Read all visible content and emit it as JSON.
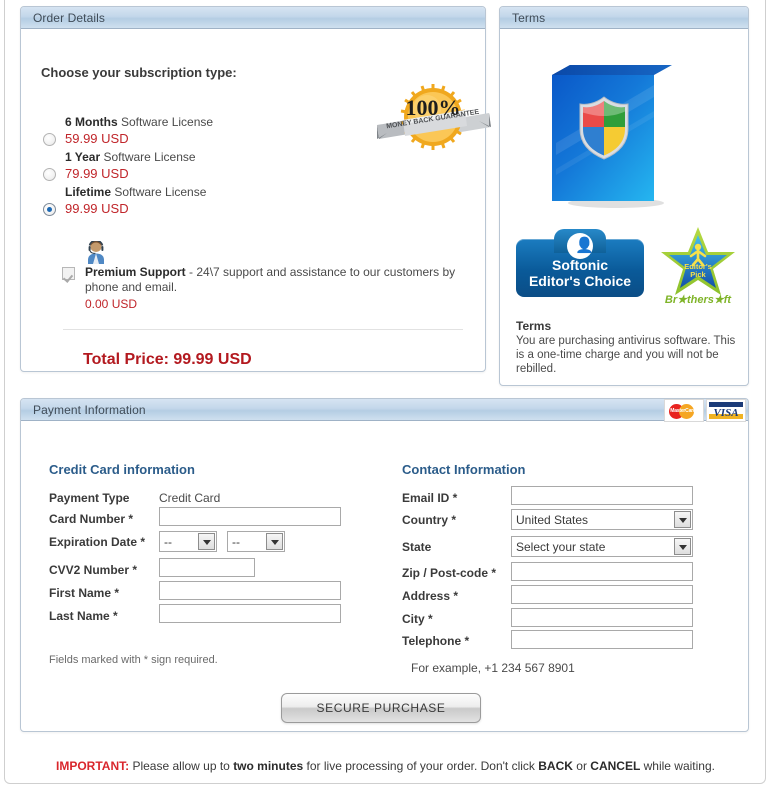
{
  "page": {
    "background": "#ffffff",
    "accent_blue": "#2b5c8a",
    "price_red": "#c0252a",
    "panel_border": "#b9c6d4"
  },
  "order_panel": {
    "title": "Order Details",
    "subscription_prompt": "Choose your subscription type:",
    "options": [
      {
        "term": "6 Months",
        "suffix": " Software License",
        "price": "59.99 USD",
        "selected": false
      },
      {
        "term": "1 Year",
        "suffix": " Software License",
        "price": "79.99 USD",
        "selected": false
      },
      {
        "term": "Lifetime",
        "suffix": " Software License",
        "price": "99.99 USD",
        "selected": true
      }
    ],
    "seal": {
      "percent_label": "100%",
      "ribbon_label": "MONEY BACK GUARANTEE",
      "icon_name": "money-back-guarantee-seal"
    },
    "premium_support": {
      "checked": true,
      "enabled": false,
      "title": "Premium Support",
      "description": " - 24\\7 support and assistance to our customers by phone and email.",
      "price": "0.00 USD",
      "icon_name": "support-agent-icon"
    },
    "total": {
      "label": "Total Price:",
      "value": "99.99 USD"
    }
  },
  "terms_panel": {
    "title": "Terms",
    "product_box": {
      "icon_name": "antivirus-software-box-shield"
    },
    "badges": [
      {
        "line1": "Softonic",
        "line2": "Editor's Choice",
        "icon_name": "softonic-editors-choice-badge"
      },
      {
        "star_line1": "Editor's",
        "star_line2": "Pick",
        "brand": "Br★thers★ft",
        "icon_name": "brothersoft-editors-pick-badge"
      }
    ],
    "terms_heading": "Terms",
    "terms_body": "You are purchasing antivirus software. This is a one-time charge and you will not be rebilled."
  },
  "payment_panel": {
    "title": "Payment Information",
    "card_logos": [
      {
        "name": "mastercard-logo",
        "label": "MasterCard"
      },
      {
        "name": "visa-logo",
        "label": "VISA"
      }
    ],
    "credit_card": {
      "heading": "Credit Card information",
      "payment_type_label": "Payment Type",
      "payment_type_value": "Credit Card",
      "card_number_label": "Card Number *",
      "card_number_value": "",
      "expiration_label": "Expiration Date *",
      "expiration_month": "--",
      "expiration_year": "--",
      "cvv_label": "CVV2 Number *",
      "cvv_value": "",
      "first_name_label": "First Name *",
      "first_name_value": "",
      "last_name_label": "Last Name *",
      "last_name_value": "",
      "required_note": "Fields marked with * sign required."
    },
    "contact": {
      "heading": "Contact Information",
      "email_label": "Email ID *",
      "email_value": "",
      "country_label": "Country *",
      "country_value": "United States",
      "state_label": "State",
      "state_value": "Select your state",
      "zip_label": "Zip / Post-code *",
      "zip_value": "",
      "address_label": "Address *",
      "address_value": "",
      "city_label": "City *",
      "city_value": "",
      "telephone_label": "Telephone *",
      "telephone_value": "",
      "phone_example": "For example, +1 234 567 8901"
    },
    "submit_label": "SECURE PURCHASE"
  },
  "footer": {
    "important_label": "IMPORTANT:",
    "text_1": " Please allow up to ",
    "bold_1": "two minutes",
    "text_2": " for live processing of your order. Don't click ",
    "bold_2": "BACK",
    "text_3": " or ",
    "bold_3": "CANCEL",
    "text_4": " while waiting."
  }
}
